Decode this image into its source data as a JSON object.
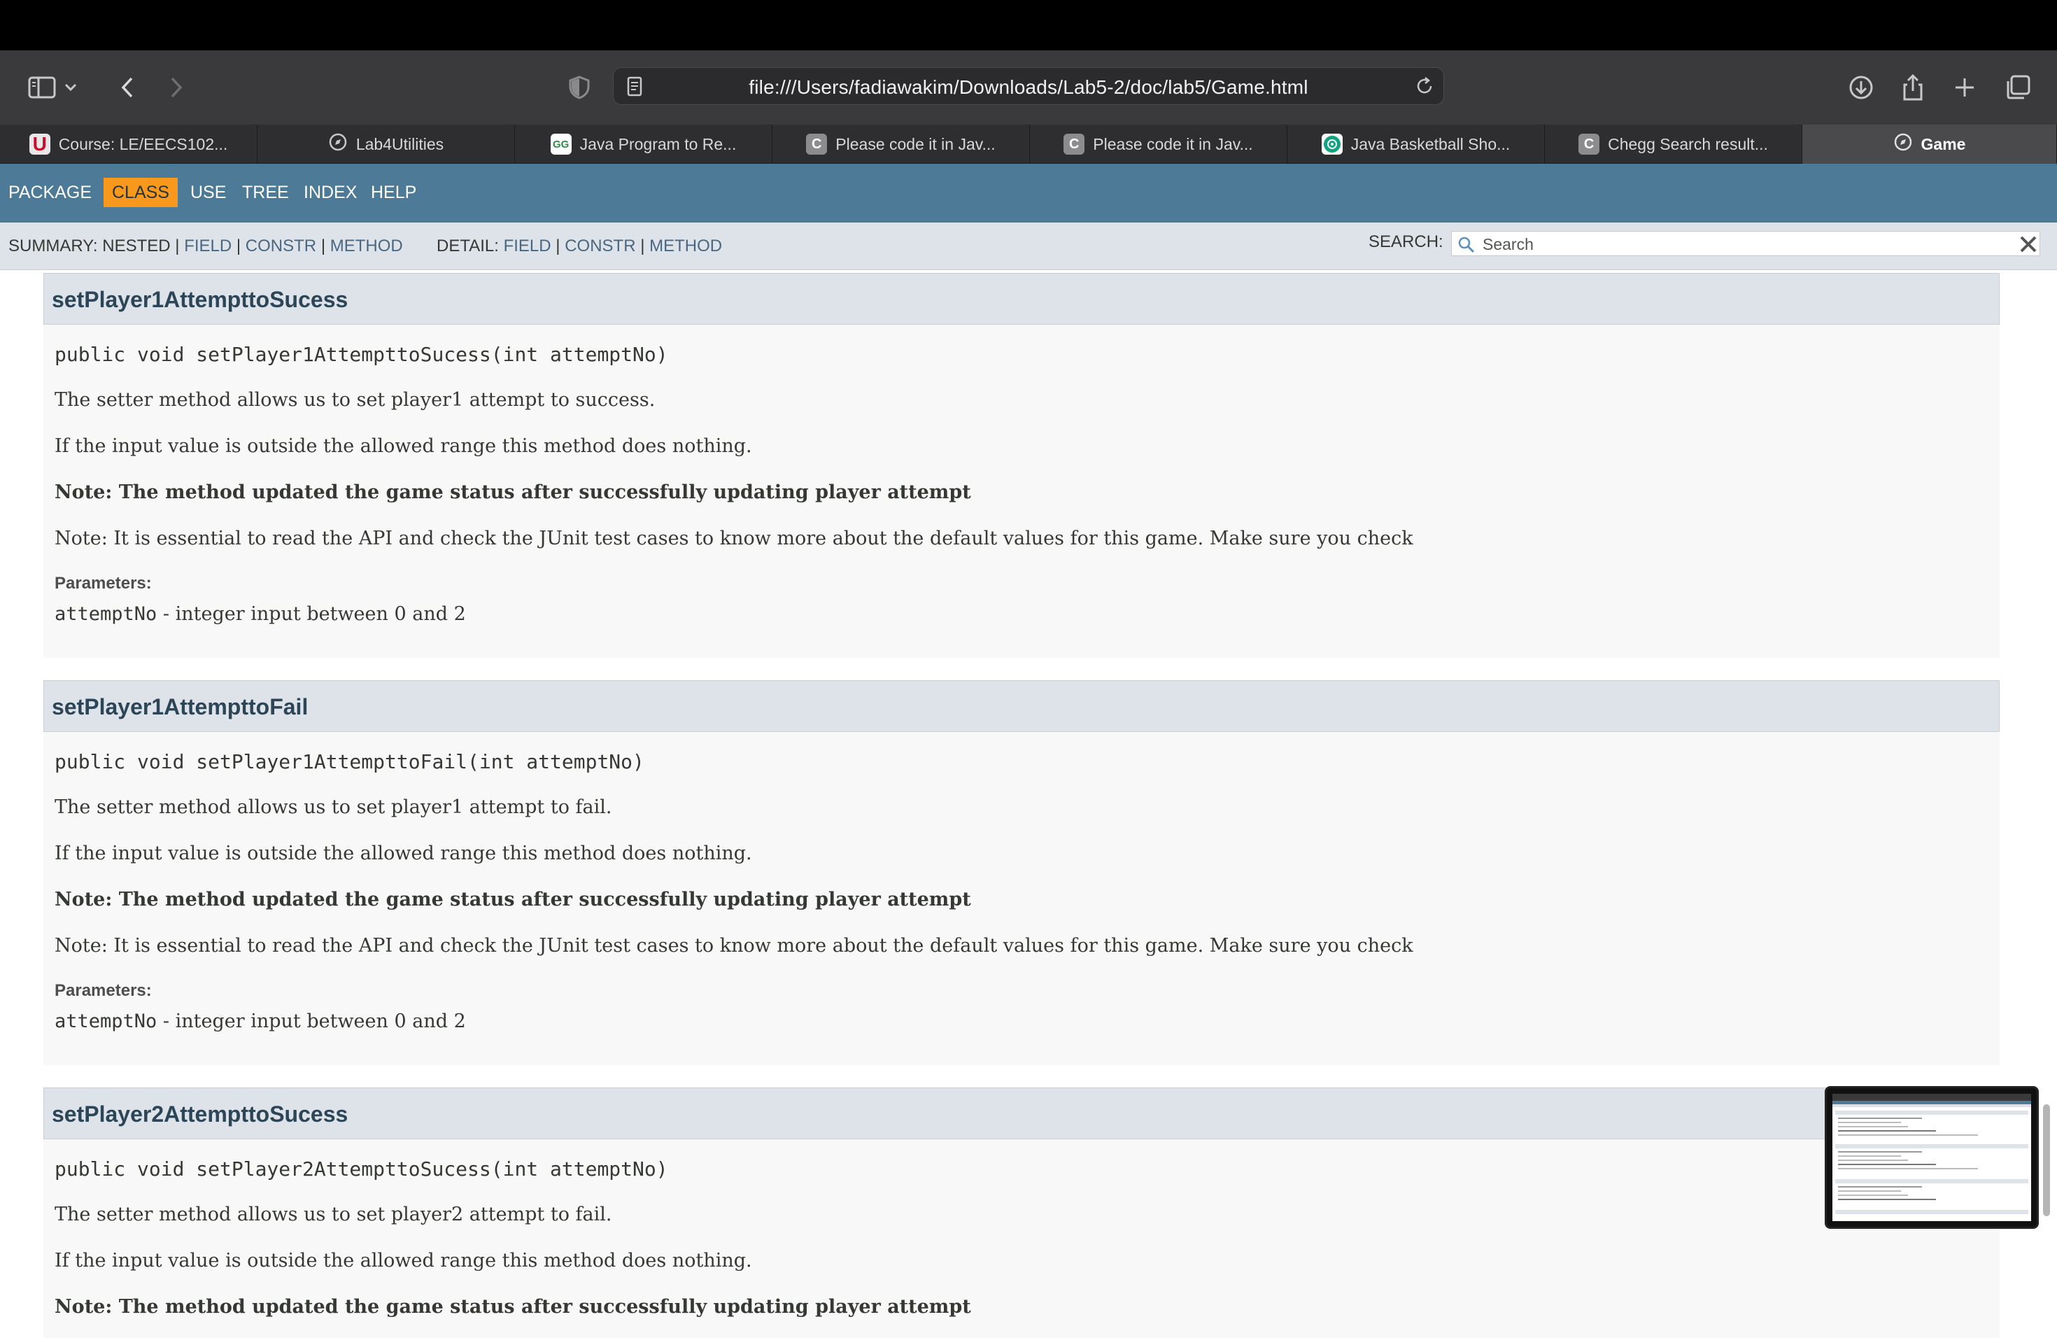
{
  "browser": {
    "url": "file:///Users/fadiawakim/Downloads/Lab5-2/doc/lab5/Game.html",
    "tabs": [
      {
        "label": "Course: LE/EECS102...",
        "icon": "u-logo-icon"
      },
      {
        "label": "Lab4Utilities",
        "icon": "compass-icon"
      },
      {
        "label": "Java Program to Re...",
        "icon": "geeksforgeeks-icon"
      },
      {
        "label": "Please code it in Jav...",
        "icon": "chegg-icon"
      },
      {
        "label": "Please code it in Jav...",
        "icon": "chegg-icon"
      },
      {
        "label": "Java Basketball Sho...",
        "icon": "chatgpt-icon"
      },
      {
        "label": "Chegg Search result...",
        "icon": "chegg-icon"
      },
      {
        "label": "Game",
        "icon": "compass-icon",
        "active": true
      }
    ]
  },
  "navbar": {
    "items": [
      "PACKAGE",
      "CLASS",
      "USE",
      "TREE",
      "INDEX",
      "HELP"
    ],
    "active": "CLASS"
  },
  "subnav": {
    "summary_label": "SUMMARY:",
    "nested": "NESTED",
    "field": "FIELD",
    "constr": "CONSTR",
    "method": "METHOD",
    "detail_label": "DETAIL:",
    "sep": "|",
    "search_label": "SEARCH:",
    "search_placeholder": "Search"
  },
  "methods": [
    {
      "name": "setPlayer1AttempttoSucess",
      "signature": "public void setPlayer1AttempttoSucess(int attemptNo)",
      "desc1": "The setter method allows us to set player1 attempt to success.",
      "desc2": "If the input value is outside the allowed range this method does nothing.",
      "note_bold": "Note: The method updated the game status after successfully updating player attempt",
      "note": "Note: It is essential to read the API and check the JUnit test cases to know more about the default values for this game. Make sure you check",
      "params_label": "Parameters:",
      "param_name": "attemptNo",
      "param_desc": " - integer input between 0 and 2"
    },
    {
      "name": "setPlayer1AttempttoFail",
      "signature": "public void setPlayer1AttempttoFail(int attemptNo)",
      "desc1": "The setter method allows us to set player1 attempt to fail.",
      "desc2": "If the input value is outside the allowed range this method does nothing.",
      "note_bold": "Note: The method updated the game status after successfully updating player attempt",
      "note": "Note: It is essential to read the API and check the JUnit test cases to know more about the default values for this game. Make sure you check",
      "params_label": "Parameters:",
      "param_name": "attemptNo",
      "param_desc": " - integer input between 0 and 2"
    },
    {
      "name": "setPlayer2AttempttoSucess",
      "signature": "public void setPlayer2AttempttoSucess(int attemptNo)",
      "desc1": "The setter method allows us to set player2 attempt to fail.",
      "desc2": "If the input value is outside the allowed range this method does nothing.",
      "note_bold": "Note: The method updated the game status after successfully updating player attempt"
    }
  ],
  "colors": {
    "navbar": "#4d7a97",
    "active_nav": "#f8981d",
    "subnav": "#dee3e9",
    "link": "#4a6782"
  }
}
